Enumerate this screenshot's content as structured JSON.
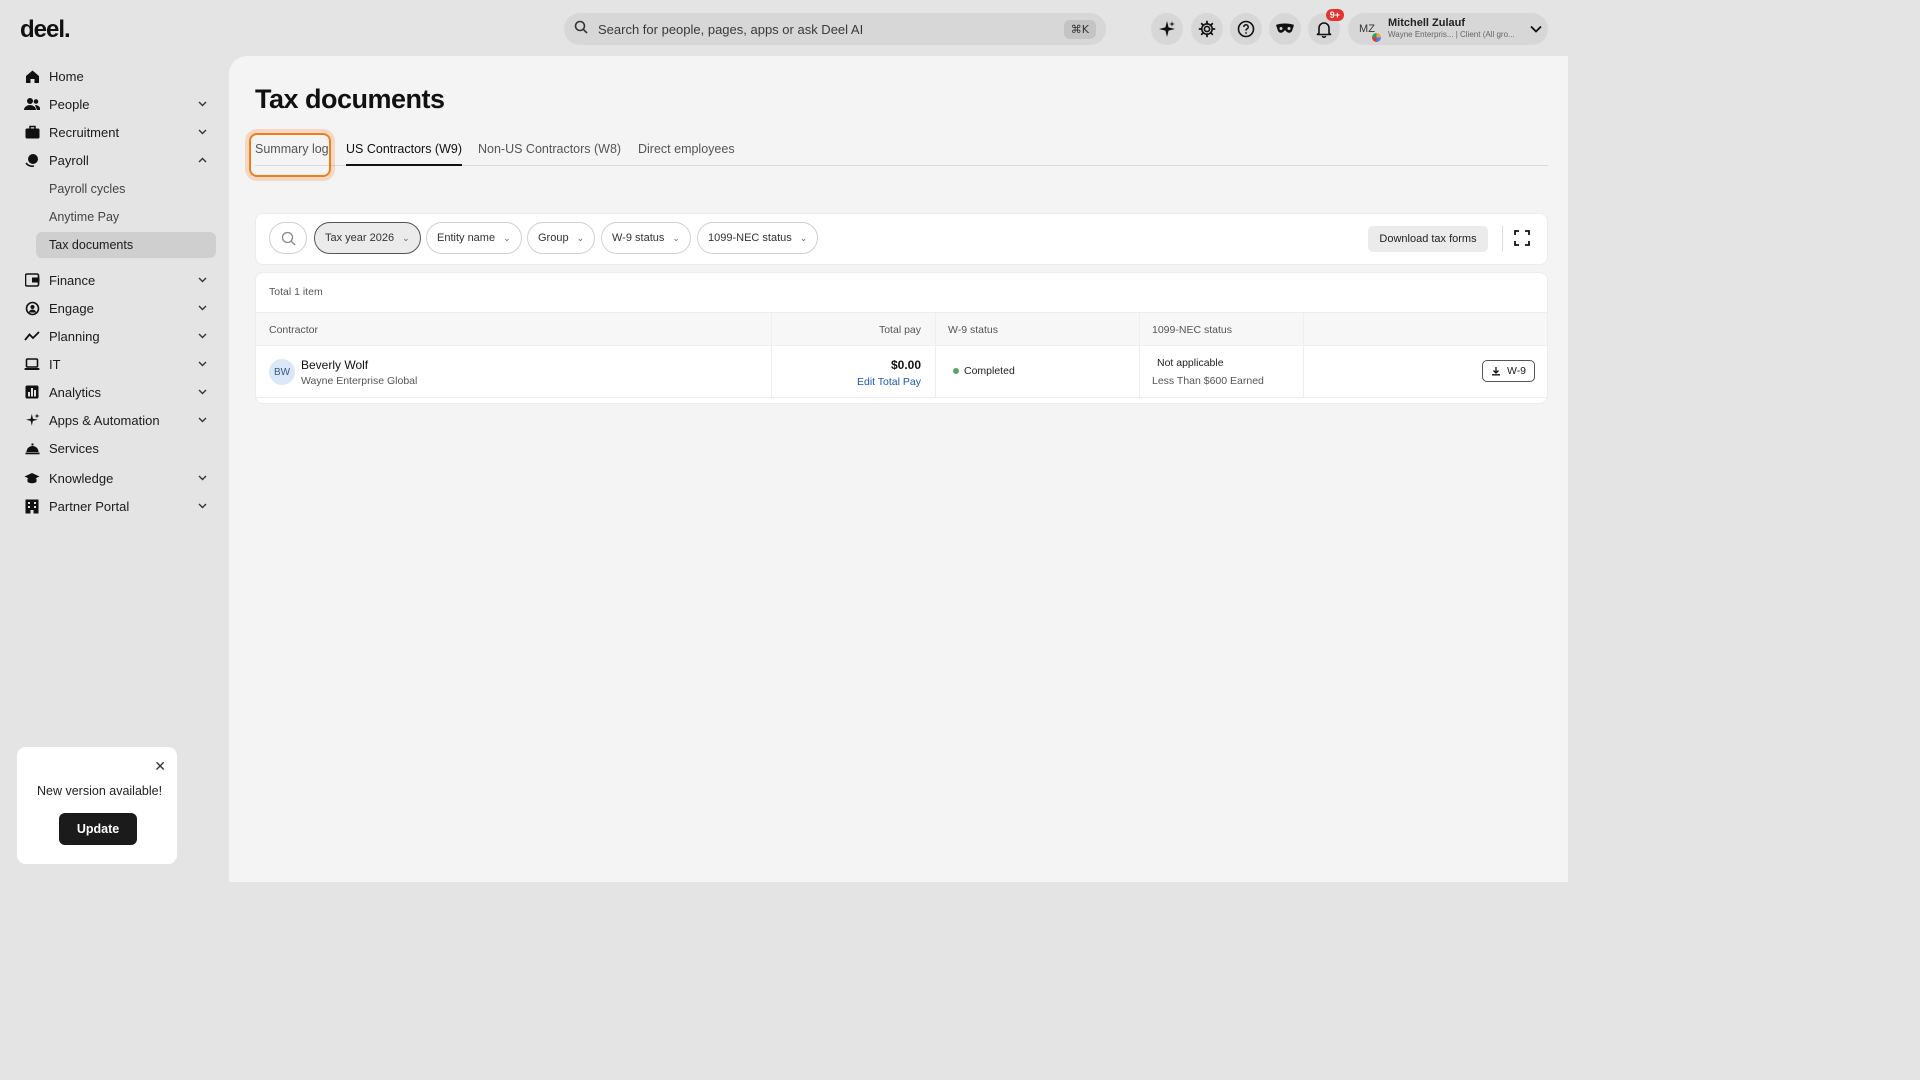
{
  "brand": {
    "logo": "deel."
  },
  "topbar": {
    "search_placeholder": "Search for people, pages, apps or ask Deel AI",
    "search_shortcut": "⌘K",
    "notifications_badge": "9+",
    "user": {
      "initials": "MZ",
      "name": "Mitchell Zulauf",
      "subtitle": "Wayne Enterpris... | Client (All gro..."
    }
  },
  "sidebar": {
    "items": [
      {
        "label": "Home",
        "icon": "home-icon"
      },
      {
        "label": "People",
        "icon": "people-icon"
      },
      {
        "label": "Recruitment",
        "icon": "briefcase-icon"
      },
      {
        "label": "Payroll",
        "icon": "payroll-icon"
      },
      {
        "label": "Finance",
        "icon": "wallet-icon"
      },
      {
        "label": "Engage",
        "icon": "engage-icon"
      },
      {
        "label": "Planning",
        "icon": "trend-icon"
      },
      {
        "label": "IT",
        "icon": "laptop-icon"
      },
      {
        "label": "Analytics",
        "icon": "bar-chart-icon"
      },
      {
        "label": "Apps & Automation",
        "icon": "sparkle-icon"
      },
      {
        "label": "Services",
        "icon": "service-bell-icon"
      },
      {
        "label": "Knowledge",
        "icon": "graduation-cap-icon"
      },
      {
        "label": "Partner Portal",
        "icon": "building-icon"
      }
    ],
    "payroll_sub": [
      "Payroll cycles",
      "Anytime Pay",
      "Tax documents"
    ]
  },
  "toast": {
    "message": "New version available!",
    "button": "Update"
  },
  "page": {
    "title": "Tax documents",
    "tabs": [
      "Summary log",
      "US Contractors (W9)",
      "Non-US Contractors (W8)",
      "Direct employees"
    ],
    "active_tab": "US Contractors (W9)",
    "filters": [
      "Tax year 2026",
      "Entity name",
      "Group",
      "W-9 status",
      "1099-NEC status"
    ],
    "download_button": "Download tax forms",
    "table": {
      "total": "Total 1 item",
      "headers": [
        "Contractor",
        "Total pay",
        "W-9 status",
        "1099-NEC status"
      ],
      "rows": [
        {
          "initials": "BW",
          "name": "Beverly Wolf",
          "entity": "Wayne Enterprise Global",
          "total_pay": "$0.00",
          "edit_pay": "Edit Total Pay",
          "w9_status": "Completed",
          "nec_status": "Not applicable",
          "nec_note": "Less Than $600 Earned",
          "action": "W-9"
        }
      ]
    }
  },
  "colors": {
    "accent_highlight": "#f07c1a",
    "status_completed": "#5fa36a",
    "link": "#1a56b8"
  }
}
